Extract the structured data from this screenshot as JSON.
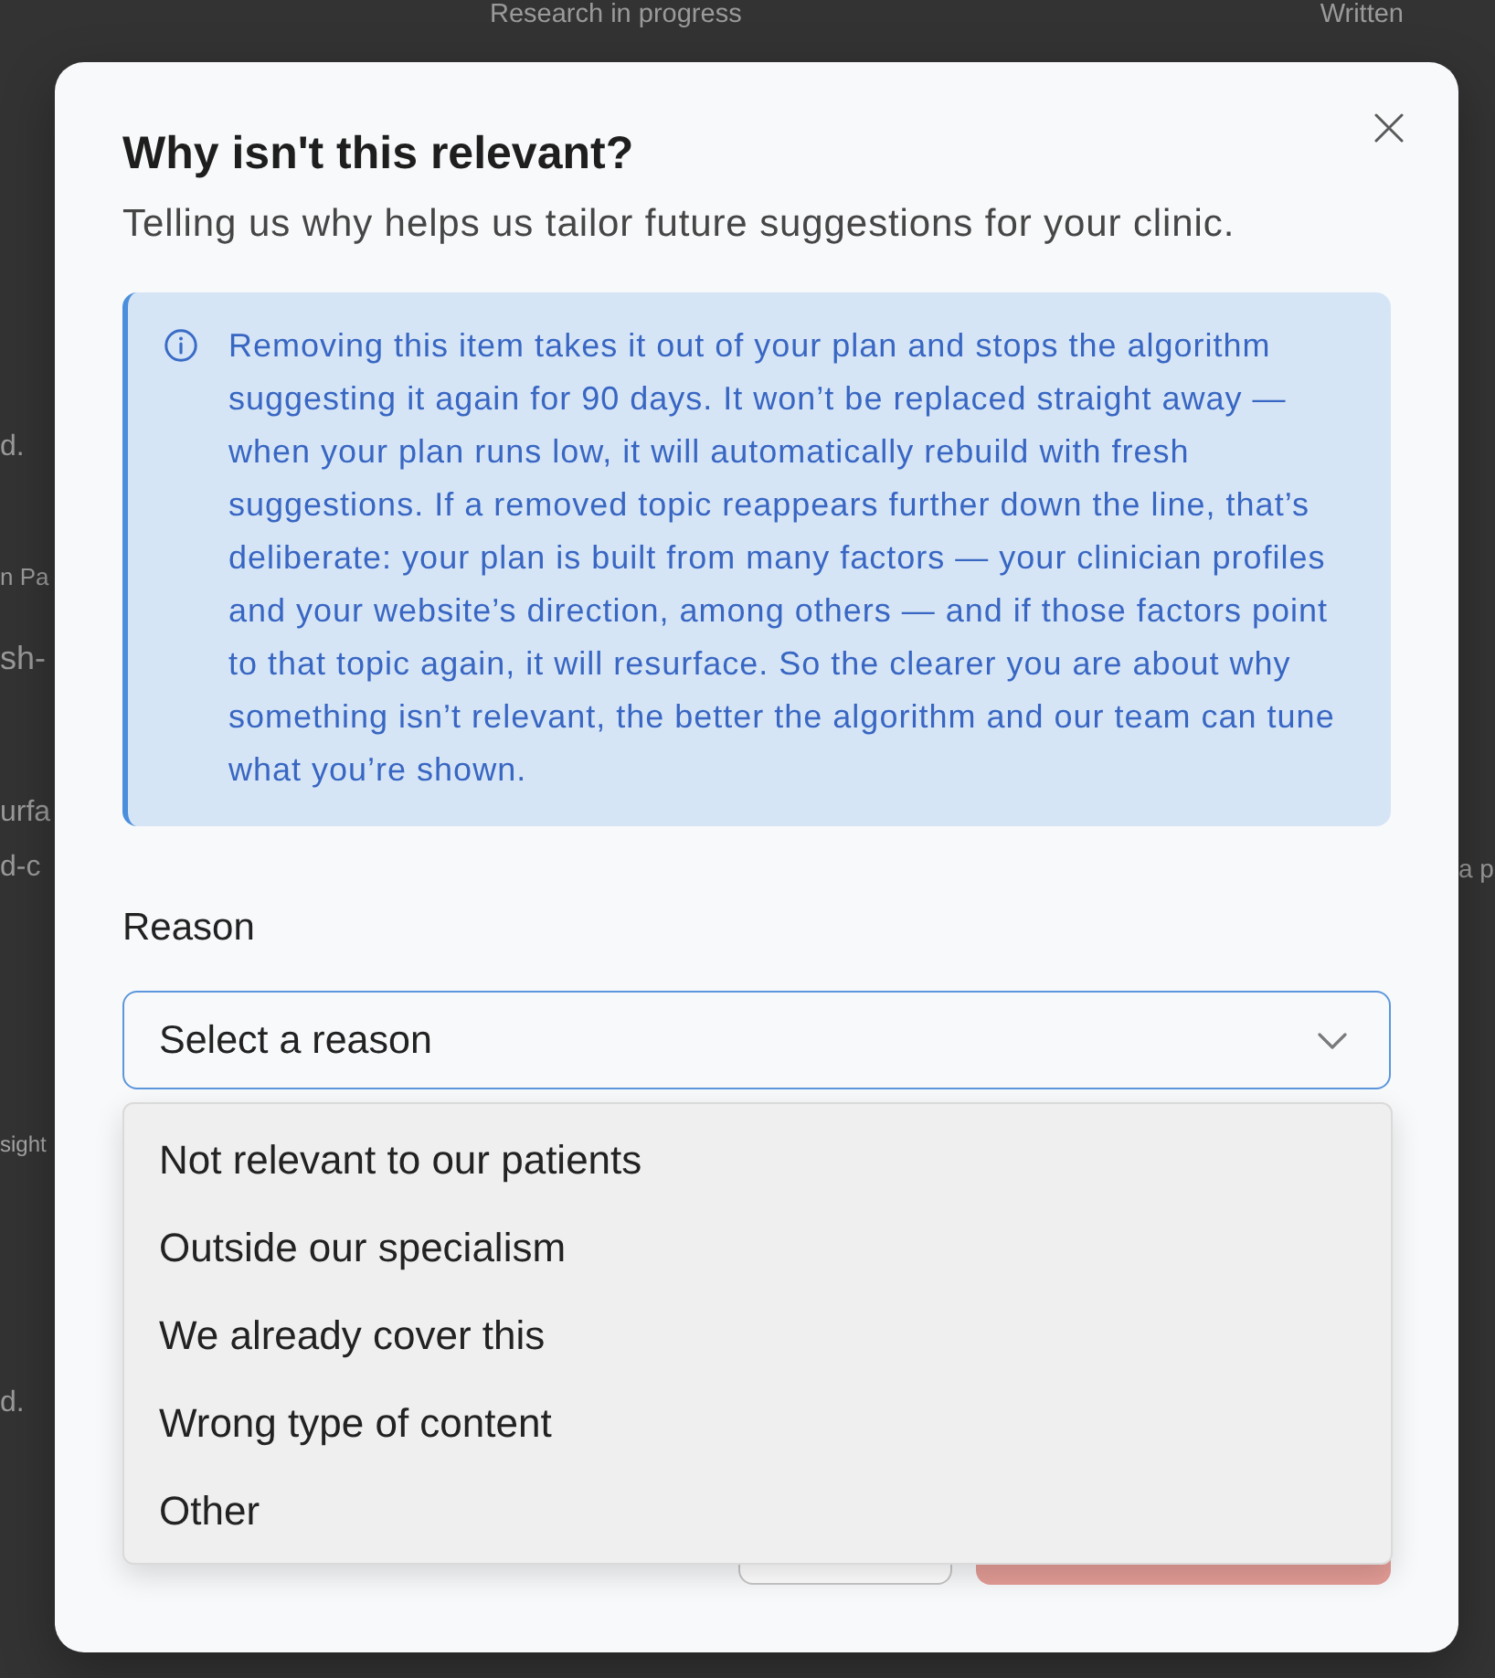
{
  "background_page": {
    "header_labels": [
      "Research in progress",
      "Written"
    ],
    "rows": [
      {
        "left_text": "d."
      },
      {
        "left_text": "n Pa"
      },
      {
        "left_text": "sh-"
      },
      {
        "left_text": "urfa"
      },
      {
        "left_text": "d-c",
        "right_text": "a p"
      },
      {
        "left_text": "sight"
      },
      {
        "left_text": "d."
      }
    ]
  },
  "dialog": {
    "title": "Why isn't this relevant?",
    "subtitle": "Telling us why helps us tailor future suggestions for your clinic.",
    "info_message": "Removing this item takes it out of your plan and stops the algorithm suggesting it again for 90 days. It won’t be replaced straight away — when your plan runs low, it will automatically rebuild with fresh suggestions. If a removed topic reappears further down the line, that’s deliberate: your plan is built from many factors — your clinician profiles and your website’s direction, among others — and if those factors point to that topic again, it will resurface. So the clearer you are about why something isn’t relevant, the better the algorithm and our team can tune what you’re shown.",
    "reason_field": {
      "label": "Reason",
      "placeholder": "Select a reason",
      "expanded": true,
      "options": [
        {
          "label": "Not relevant to our patients",
          "selected": false
        },
        {
          "label": "Outside our specialism",
          "selected": false
        },
        {
          "label": "We already cover this",
          "selected": false
        },
        {
          "label": "Wrong type of content",
          "selected": false
        },
        {
          "label": "Other",
          "selected": false
        }
      ]
    },
    "footer_buttons": [
      {
        "kind": "secondary"
      },
      {
        "kind": "primary"
      }
    ]
  }
}
